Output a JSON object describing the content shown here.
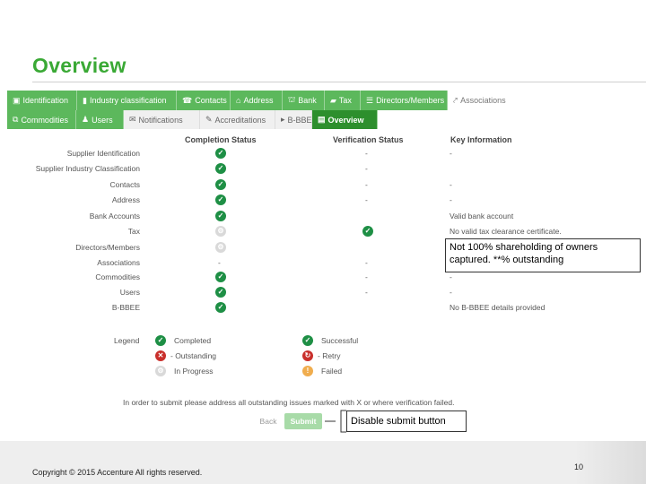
{
  "title": "Overview",
  "tabs_row1": [
    {
      "icon": "briefcase-icon",
      "glyph": "▣",
      "label": "Identification"
    },
    {
      "icon": "building-icon",
      "glyph": "▮",
      "label": "Industry classification"
    },
    {
      "icon": "phone-icon",
      "glyph": "☎",
      "label": "Contacts"
    },
    {
      "icon": "home-icon",
      "glyph": "⌂",
      "label": "Address"
    },
    {
      "icon": "bank-icon",
      "glyph": "⛫",
      "label": "Bank"
    },
    {
      "icon": "folder-icon",
      "glyph": "▰",
      "label": "Tax"
    },
    {
      "icon": "people-icon",
      "glyph": "☰",
      "label": "Directors/Members"
    },
    {
      "icon": "link-icon",
      "glyph": "⤤",
      "label": "Associations"
    }
  ],
  "tabs_row2": [
    {
      "icon": "tag-icon",
      "glyph": "⧉",
      "label": "Commodities"
    },
    {
      "icon": "user-icon",
      "glyph": "♟",
      "label": "Users"
    },
    {
      "icon": "mail-icon",
      "glyph": "✉",
      "label": "Notifications"
    },
    {
      "icon": "certificate-icon",
      "glyph": "✎",
      "label": "Accreditations"
    },
    {
      "icon": "chevron-right-icon",
      "glyph": "▸",
      "label": "B-BBEE"
    },
    {
      "icon": "list-icon",
      "glyph": "▤",
      "label": "Overview"
    }
  ],
  "headers": {
    "completion": "Completion Status",
    "verification": "Verification Status",
    "key_info": "Key Information"
  },
  "rows": [
    {
      "label": "Supplier Identification",
      "completion": "ok",
      "verification": "-",
      "info": "-"
    },
    {
      "label": "Supplier Industry Classification",
      "completion": "ok",
      "verification": "-",
      "info": ""
    },
    {
      "label": "Contacts",
      "completion": "ok",
      "verification": "-",
      "info": "-"
    },
    {
      "label": "Address",
      "completion": "ok",
      "verification": "-",
      "info": "-"
    },
    {
      "label": "Bank Accounts",
      "completion": "ok",
      "verification": "",
      "info": "Valid bank account"
    },
    {
      "label": "Tax",
      "completion": "prog",
      "verification": "ok",
      "info": "No valid tax clearance certificate."
    },
    {
      "label": "Directors/Members",
      "completion": "prog",
      "verification": "",
      "info": ""
    },
    {
      "label": "Associations",
      "completion": "-",
      "verification": "-",
      "info": ""
    },
    {
      "label": "Commodities",
      "completion": "ok",
      "verification": "-",
      "info": "-"
    },
    {
      "label": "Users",
      "completion": "ok",
      "verification": "-",
      "info": "-"
    },
    {
      "label": "B-BBEE",
      "completion": "ok",
      "verification": "",
      "info": "No B-BBEE details provided"
    }
  ],
  "callout_owners": "Not 100% shareholding of owners captured. **% outstanding",
  "legend": {
    "title": "Legend",
    "completed": "Completed",
    "outstanding": "- Outstanding",
    "in_progress": "In Progress",
    "successful": "Successful",
    "retry": "- Retry",
    "failed": "Failed"
  },
  "note": "In order to submit please address all outstanding issues marked with X or where verification failed.",
  "back_label": "Back",
  "submit_label": "Submit",
  "callout_submit": "Disable submit button",
  "copyright": "Copyright © 2015 Accenture All rights reserved.",
  "page_number": "10",
  "colors": {
    "brand_green": "#3aa935",
    "tab_green": "#5cb85c",
    "check_green": "#1e8f45",
    "error_red": "#c9302c",
    "warn_orange": "#f0ad4e"
  }
}
